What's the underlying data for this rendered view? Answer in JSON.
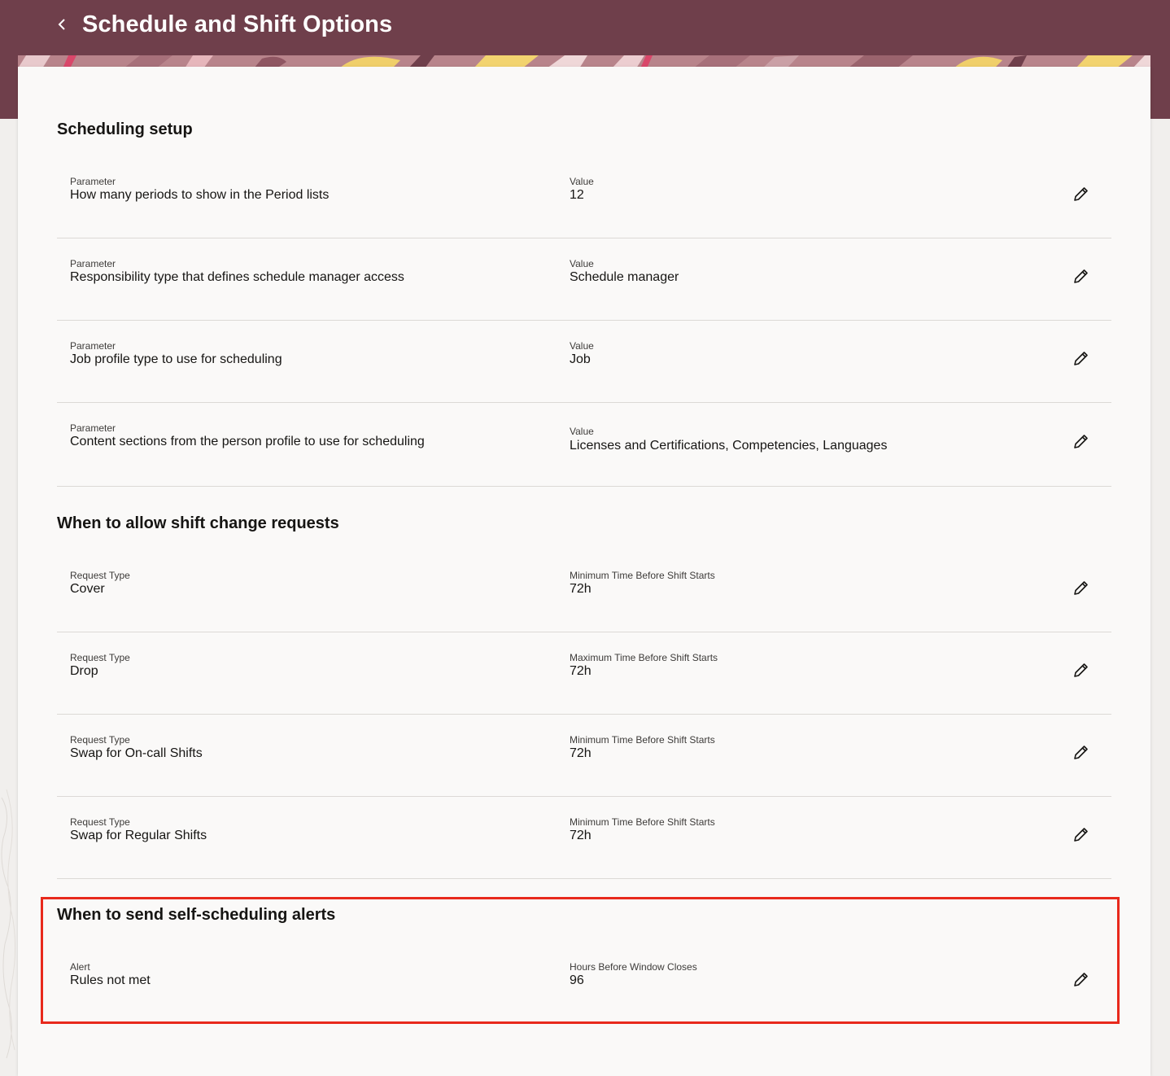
{
  "header": {
    "title": "Schedule and Shift Options",
    "back_icon": "chevron-left-icon",
    "background_color": "#6f3f4b"
  },
  "sections": [
    {
      "title": "Scheduling setup",
      "rows": [
        {
          "label1": "Parameter",
          "value1": "How many periods to show in the Period lists",
          "label2": "Value",
          "value2": "12"
        },
        {
          "label1": "Parameter",
          "value1": "Responsibility type that defines schedule manager access",
          "label2": "Value",
          "value2": "Schedule manager"
        },
        {
          "label1": "Parameter",
          "value1": "Job profile type to use for scheduling",
          "label2": "Value",
          "value2": "Job"
        },
        {
          "label1": "Parameter",
          "value1": "Content sections from the person profile to use for scheduling",
          "label2": "Value",
          "value2": "Licenses and Certifications, Competencies, Languages"
        }
      ]
    },
    {
      "title": "When to allow shift change requests",
      "rows": [
        {
          "label1": "Request Type",
          "value1": "Cover",
          "label2": "Minimum Time Before Shift Starts",
          "value2": "72h"
        },
        {
          "label1": "Request Type",
          "value1": "Drop",
          "label2": "Maximum Time Before Shift Starts",
          "value2": "72h"
        },
        {
          "label1": "Request Type",
          "value1": "Swap for On-call Shifts",
          "label2": "Minimum Time Before Shift Starts",
          "value2": "72h"
        },
        {
          "label1": "Request Type",
          "value1": "Swap for Regular Shifts",
          "label2": "Minimum Time Before Shift Starts",
          "value2": "72h"
        }
      ]
    },
    {
      "title": "When to send self-scheduling alerts",
      "rows": [
        {
          "label1": "Alert",
          "value1": "Rules not met",
          "label2": "Hours Before Window Closes",
          "value2": "96"
        }
      ]
    }
  ],
  "icons": {
    "edit": "pencil-icon"
  },
  "colors": {
    "highlight_border": "#e8291c",
    "divider": "#dcd9d6",
    "card_background": "#faf9f8"
  }
}
